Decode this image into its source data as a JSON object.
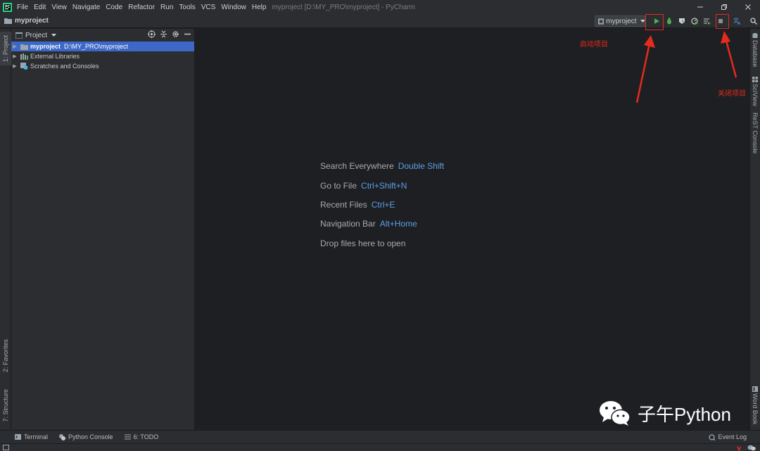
{
  "titlebar": {
    "menus": [
      "File",
      "Edit",
      "View",
      "Navigate",
      "Code",
      "Refactor",
      "Run",
      "Tools",
      "VCS",
      "Window",
      "Help"
    ],
    "window_title": "myproject [D:\\MY_PRO\\myproject] - PyCharm"
  },
  "navbar": {
    "breadcrumb": "myproject",
    "run_config": "myproject"
  },
  "left_stripe": {
    "project_tab": "1: Project",
    "favorites_tab": "2: Favorites",
    "structure_tab": "7: Structure"
  },
  "project_panel": {
    "title": "Project",
    "tree": [
      {
        "label": "myproject",
        "path": "D:\\MY_PRO\\myproject"
      },
      {
        "label": "External Libraries"
      },
      {
        "label": "Scratches and Consoles"
      }
    ]
  },
  "editor": {
    "hints": [
      {
        "label": "Search Everywhere",
        "key": "Double Shift"
      },
      {
        "label": "Go to File",
        "key": "Ctrl+Shift+N"
      },
      {
        "label": "Recent Files",
        "key": "Ctrl+E"
      },
      {
        "label": "Navigation Bar",
        "key": "Alt+Home"
      },
      {
        "label": "Drop files here to open",
        "key": ""
      }
    ]
  },
  "right_stripe": {
    "tabs": [
      "Database",
      "SciView",
      "ReST Console",
      "Word Book"
    ]
  },
  "bottombar": {
    "terminal": "Terminal",
    "python_console": "Python Console",
    "todo": "6: TODO",
    "event_log": "Event Log"
  },
  "annotations": {
    "run_label": "启动项目",
    "stop_label": "关闭项目",
    "color": "#e52a1f"
  },
  "watermark": {
    "text": "子午Python"
  },
  "colors": {
    "accent_blue": "#5a9fe8",
    "selection": "#3d68c8",
    "run_green": "#4caf50"
  }
}
